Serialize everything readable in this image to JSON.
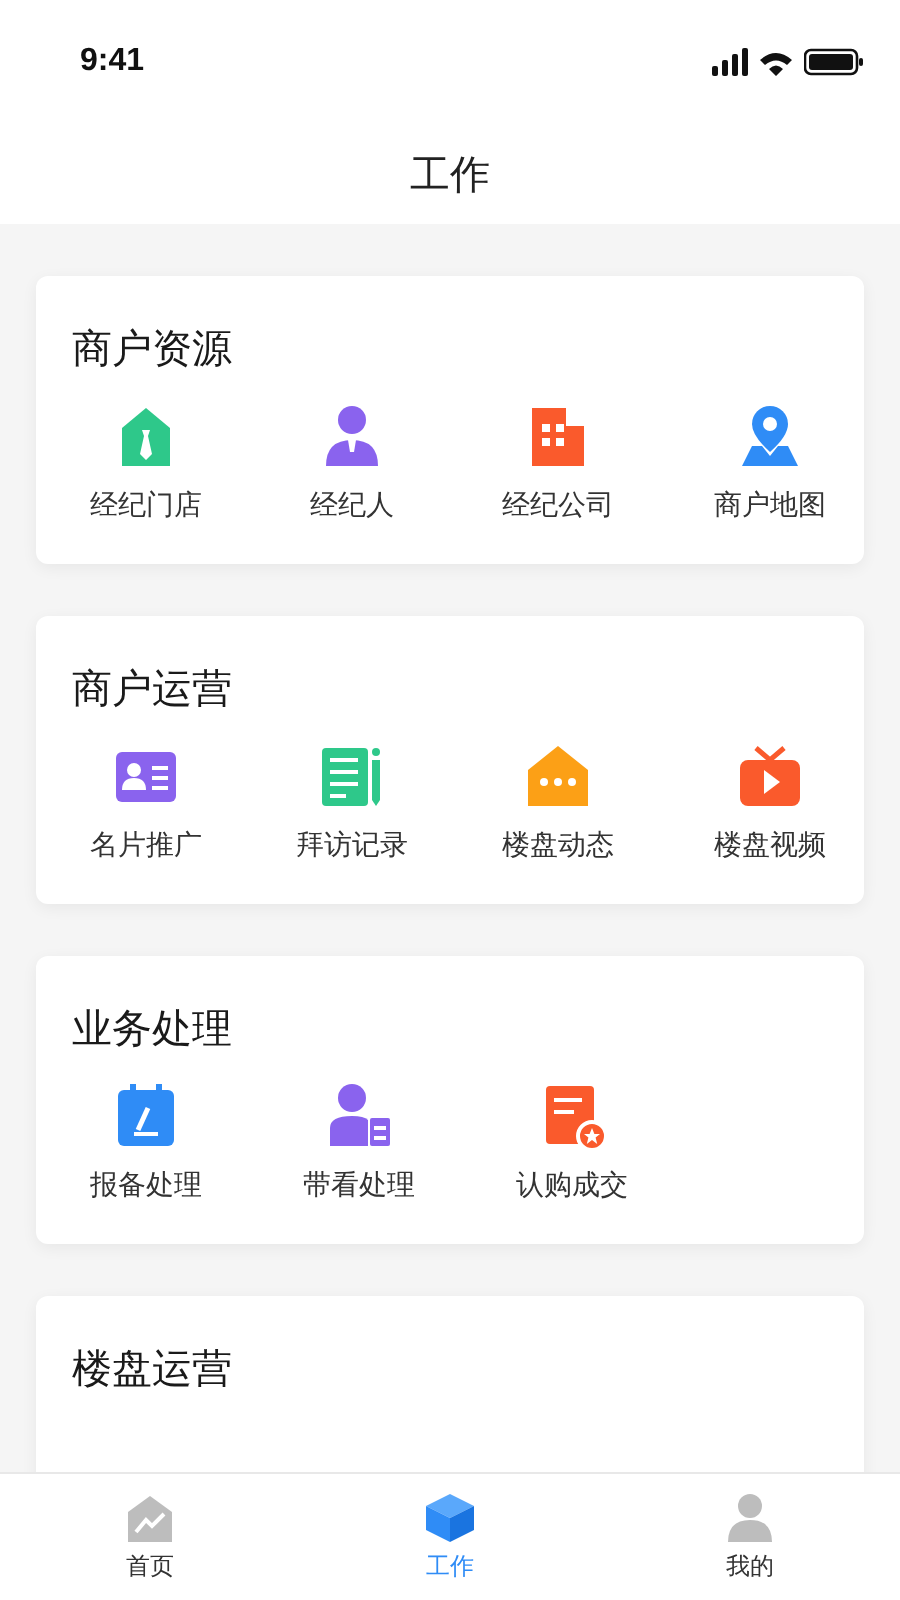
{
  "status_bar": {
    "time": "9:41"
  },
  "header": {
    "title": "工作"
  },
  "sections": [
    {
      "title": "商户资源",
      "items": [
        {
          "label": "经纪门店"
        },
        {
          "label": "经纪人"
        },
        {
          "label": "经纪公司"
        },
        {
          "label": "商户地图"
        }
      ]
    },
    {
      "title": "商户运营",
      "items": [
        {
          "label": "名片推广"
        },
        {
          "label": "拜访记录"
        },
        {
          "label": "楼盘动态"
        },
        {
          "label": "楼盘视频"
        }
      ]
    },
    {
      "title": "业务处理",
      "items": [
        {
          "label": "报备处理"
        },
        {
          "label": "带看处理"
        },
        {
          "label": "认购成交"
        }
      ]
    },
    {
      "title": "楼盘运营"
    }
  ],
  "tab_bar": [
    {
      "label": "首页",
      "selected": false
    },
    {
      "label": "工作",
      "selected": true
    },
    {
      "label": "我的",
      "selected": false
    }
  ]
}
